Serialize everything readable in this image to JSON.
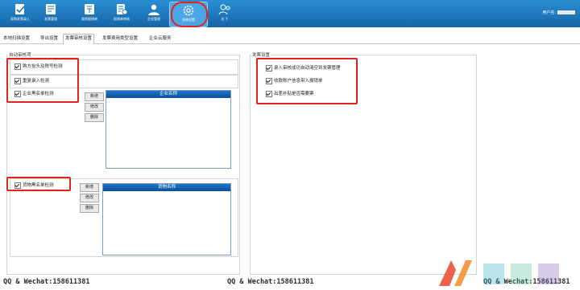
{
  "toolbar": {
    "buttons": [
      {
        "label": "采购发票录入",
        "icon": "invoice-entry-icon"
      },
      {
        "label": "发票管理",
        "icon": "invoice-manage-icon"
      },
      {
        "label": "我的报销单",
        "icon": "reimburse-icon"
      },
      {
        "label": "报销单审核",
        "icon": "audit-icon"
      },
      {
        "label": "企业管理",
        "icon": "company-icon"
      },
      {
        "label": "系统设置",
        "icon": "settings-icon"
      },
      {
        "label": "关 于",
        "icon": "about-icon"
      }
    ],
    "active": "系统设置",
    "user_label": "用户名:"
  },
  "tabs": [
    {
      "label": "本地扫描设置"
    },
    {
      "label": "导出设置"
    },
    {
      "label": "发票审核设置"
    },
    {
      "label": "发票费用类型设置"
    },
    {
      "label": "企业云服务"
    }
  ],
  "active_tab": "发票审核设置",
  "auto_review": {
    "title": "自动审核项",
    "checks": [
      {
        "label": "购方抬头及税号检测",
        "checked": true
      },
      {
        "label": "重复录入检测",
        "checked": true
      },
      {
        "label": "企业黑名单检测",
        "checked": true
      }
    ],
    "company_grid_header": "企业名称",
    "goods_check": {
      "label": "货物黑名单检测",
      "checked": true
    },
    "goods_grid_header": "货物名称",
    "buttons": {
      "add": "新增",
      "edit": "修改",
      "delete": "删除"
    }
  },
  "invoice_settings": {
    "title": "发票设置",
    "checks": [
      {
        "label": "录入审核成功自动清空到发票管理",
        "checked": true
      },
      {
        "label": "收款账户信息带入报销单",
        "checked": true
      },
      {
        "label": "出差补贴是否需要票",
        "checked": true
      }
    ]
  },
  "watermark": {
    "text": "QQ & Wechat:158611381"
  },
  "colors": {
    "toolbar": "#1a73bf",
    "grid_header": "#0b5aa8",
    "highlight": "#e0231b"
  }
}
